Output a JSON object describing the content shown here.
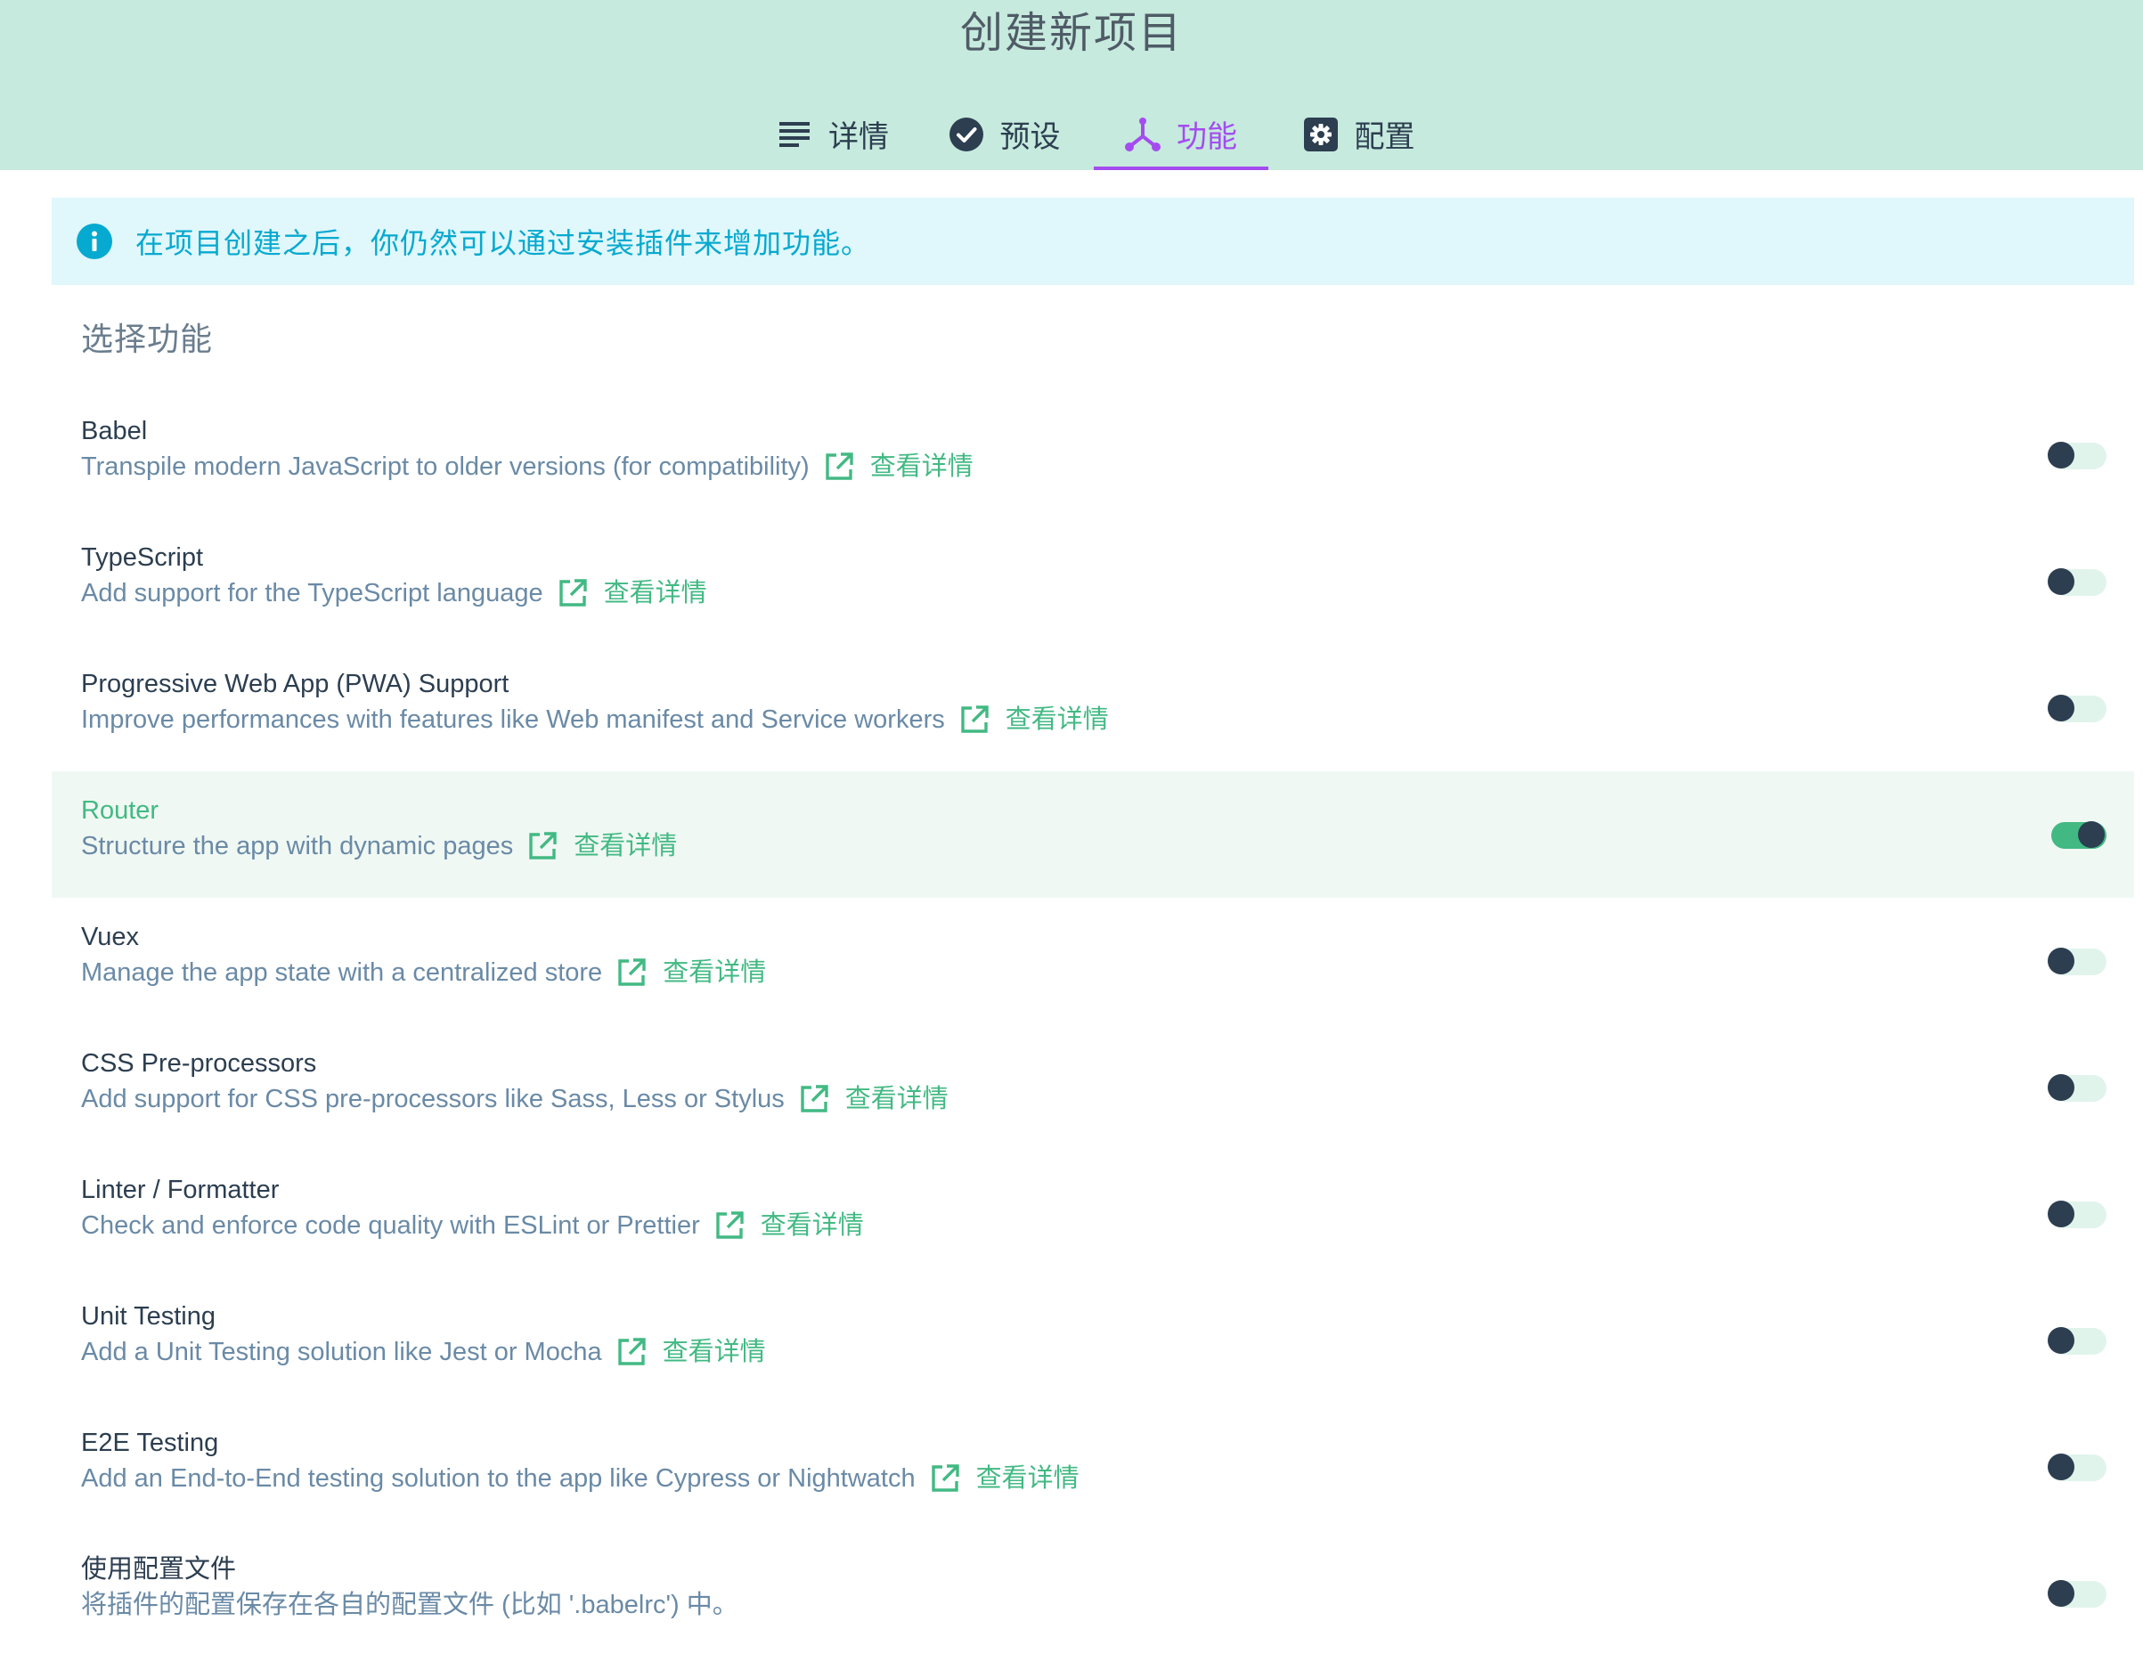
{
  "header": {
    "title": "创建新项目",
    "tabs": [
      {
        "label": "详情",
        "icon": "list-icon",
        "active": false
      },
      {
        "label": "预设",
        "icon": "check-circle-icon",
        "active": false
      },
      {
        "label": "功能",
        "icon": "fork-icon",
        "active": true
      },
      {
        "label": "配置",
        "icon": "gear-icon",
        "active": false
      }
    ]
  },
  "info_banner": {
    "icon": "info-icon",
    "text": "在项目创建之后，你仍然可以通过安装插件来增加功能。"
  },
  "section_title": "选择功能",
  "more_label": "查看详情",
  "colors": {
    "header_bg": "#c6eadd",
    "accent_purple": "#a44cf0",
    "accent_green": "#42b983",
    "info_text": "#06a9cf",
    "info_bg": "#e0f7fb",
    "knob": "#2c3e50"
  },
  "features": [
    {
      "name": "Babel",
      "description": "Transpile modern JavaScript to older versions (for compatibility)",
      "has_link": true,
      "enabled": false
    },
    {
      "name": "TypeScript",
      "description": "Add support for the TypeScript language",
      "has_link": true,
      "enabled": false
    },
    {
      "name": "Progressive Web App (PWA) Support",
      "description": "Improve performances with features like Web manifest and Service workers",
      "has_link": true,
      "enabled": false
    },
    {
      "name": "Router",
      "description": "Structure the app with dynamic pages",
      "has_link": true,
      "enabled": true
    },
    {
      "name": "Vuex",
      "description": "Manage the app state with a centralized store",
      "has_link": true,
      "enabled": false
    },
    {
      "name": "CSS Pre-processors",
      "description": "Add support for CSS pre-processors like Sass, Less or Stylus",
      "has_link": true,
      "enabled": false
    },
    {
      "name": "Linter / Formatter",
      "description": "Check and enforce code quality with ESLint or Prettier",
      "has_link": true,
      "enabled": false
    },
    {
      "name": "Unit Testing",
      "description": "Add a Unit Testing solution like Jest or Mocha",
      "has_link": true,
      "enabled": false
    },
    {
      "name": "E2E Testing",
      "description": "Add an End-to-End testing solution to the app like Cypress or Nightwatch",
      "has_link": true,
      "enabled": false
    },
    {
      "name": "使用配置文件",
      "description": "将插件的配置保存在各自的配置文件 (比如 '.babelrc') 中。",
      "has_link": false,
      "enabled": false
    }
  ]
}
